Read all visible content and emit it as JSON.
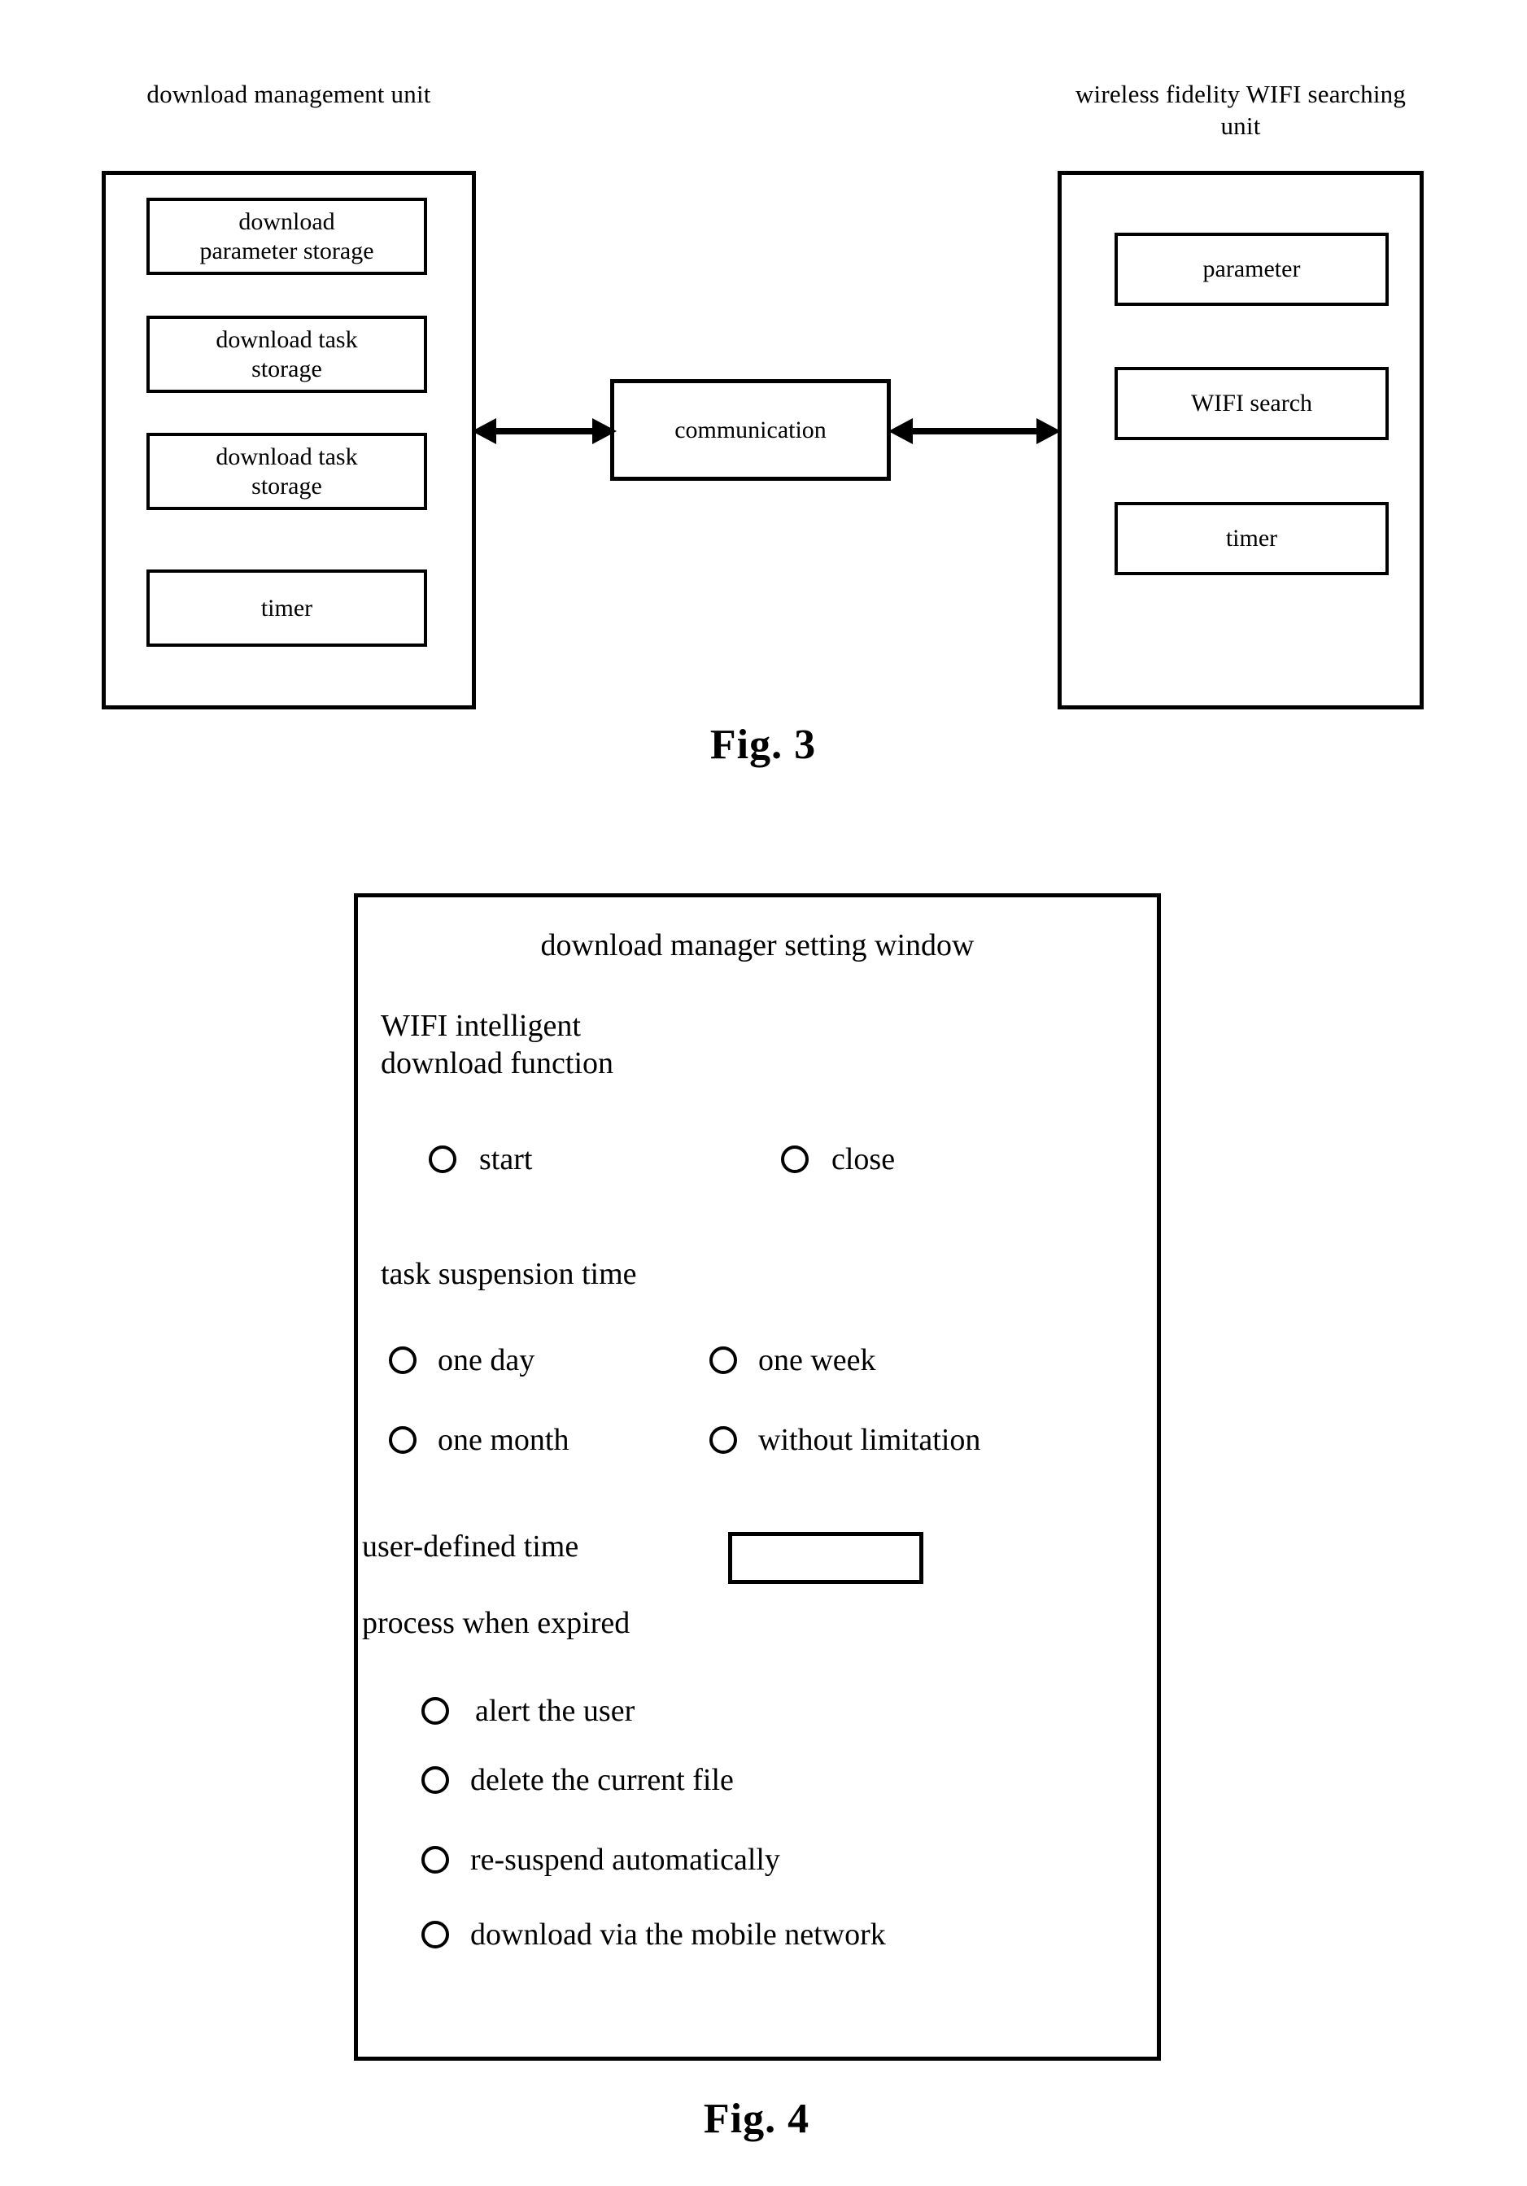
{
  "figures": [
    {
      "id": "fig3",
      "caption": "Fig. 3",
      "left_unit": {
        "caption": "download management\nunit",
        "blocks": [
          {
            "label": "download\nparameter storage"
          },
          {
            "label": "download task\nstorage"
          },
          {
            "label": "download task\nstorage"
          },
          {
            "label": "timer"
          }
        ]
      },
      "center": {
        "label": "communication"
      },
      "right_unit": {
        "caption": "wireless fidelity WIFI\nsearching unit",
        "blocks": [
          {
            "label": "parameter"
          },
          {
            "label": "WIFI search"
          },
          {
            "label": "timer"
          }
        ]
      },
      "connectors": [
        {
          "name": "left-bidirectional-arrow",
          "style": "double-headed"
        },
        {
          "name": "right-bidirectional-arrow",
          "style": "double-headed"
        }
      ]
    },
    {
      "id": "fig4",
      "caption": "Fig. 4",
      "window": {
        "title": "download manager setting window",
        "groups": [
          {
            "key": "wifi_function",
            "label": "WIFI intelligent\ndownload function",
            "options": [
              {
                "label": "start",
                "selected": false
              },
              {
                "label": "close",
                "selected": false
              }
            ]
          },
          {
            "key": "task_suspension_time",
            "label": "task suspension time",
            "options": [
              {
                "label": "one day",
                "selected": false
              },
              {
                "label": "one week",
                "selected": false
              },
              {
                "label": "one month",
                "selected": false
              },
              {
                "label": "without limitation",
                "selected": false
              }
            ]
          }
        ],
        "user_defined_time": {
          "label": "user-defined time",
          "value": "",
          "placeholder": ""
        },
        "process_when_expired": {
          "label": "process when expired",
          "options": [
            {
              "label": "alert the user",
              "selected": false
            },
            {
              "label": "delete the current file",
              "selected": false
            },
            {
              "label": "re-suspend automatically",
              "selected": false
            },
            {
              "label": "download via the mobile network",
              "selected": false
            }
          ]
        }
      }
    }
  ],
  "colors": {
    "ink": "#000000",
    "paper": "#ffffff"
  }
}
